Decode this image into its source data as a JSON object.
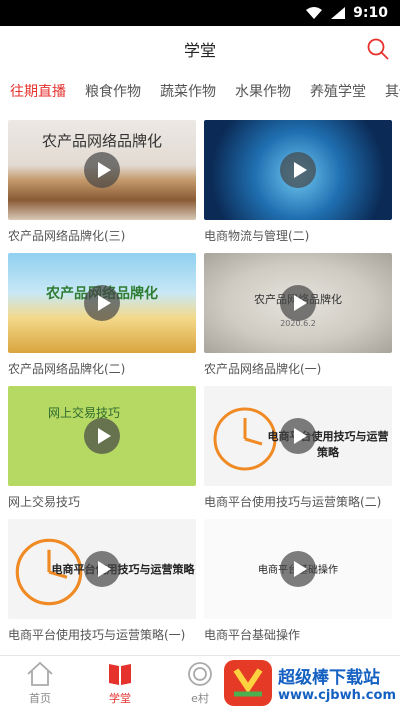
{
  "statusbar": {
    "time": "9:10"
  },
  "header": {
    "title": "学堂"
  },
  "tabs": [
    {
      "label": "往期直播",
      "active": true
    },
    {
      "label": "粮食作物",
      "active": false
    },
    {
      "label": "蔬菜作物",
      "active": false
    },
    {
      "label": "水果作物",
      "active": false
    },
    {
      "label": "养殖学堂",
      "active": false
    },
    {
      "label": "其他",
      "active": false
    }
  ],
  "videos": [
    {
      "title": "农产品网络品牌化(三)",
      "thumb_text": "农产品网络品牌化"
    },
    {
      "title": "电商物流与管理(二)",
      "thumb_text": ""
    },
    {
      "title": "农产品网络品牌化(二)",
      "thumb_text": "农产品网络品牌化"
    },
    {
      "title": "农产品网络品牌化(一)",
      "thumb_text": "农产品网络品牌化",
      "thumb_date": "2020.6.2"
    },
    {
      "title": "网上交易技巧",
      "thumb_text": "网上交易技巧"
    },
    {
      "title": "电商平台使用技巧与运营策略(二)",
      "thumb_text": "电商平台使用技巧与运营策略"
    },
    {
      "title": "电商平台使用技巧与运营策略(一)",
      "thumb_text": "电商平台使用技巧与运营策略"
    },
    {
      "title": "电商平台基础操作",
      "thumb_text": "电商平台基础操作"
    }
  ],
  "bottom_nav": [
    {
      "label": "首页",
      "icon": "home-icon",
      "active": false
    },
    {
      "label": "学堂",
      "icon": "book-icon",
      "active": true
    },
    {
      "label": "e村",
      "icon": "circle-icon",
      "active": false
    }
  ],
  "watermark": {
    "title": "超级棒下载站",
    "url": "www.cjbwh.com"
  },
  "colors": {
    "accent": "#e5322d",
    "watermark": "#1561c2"
  }
}
